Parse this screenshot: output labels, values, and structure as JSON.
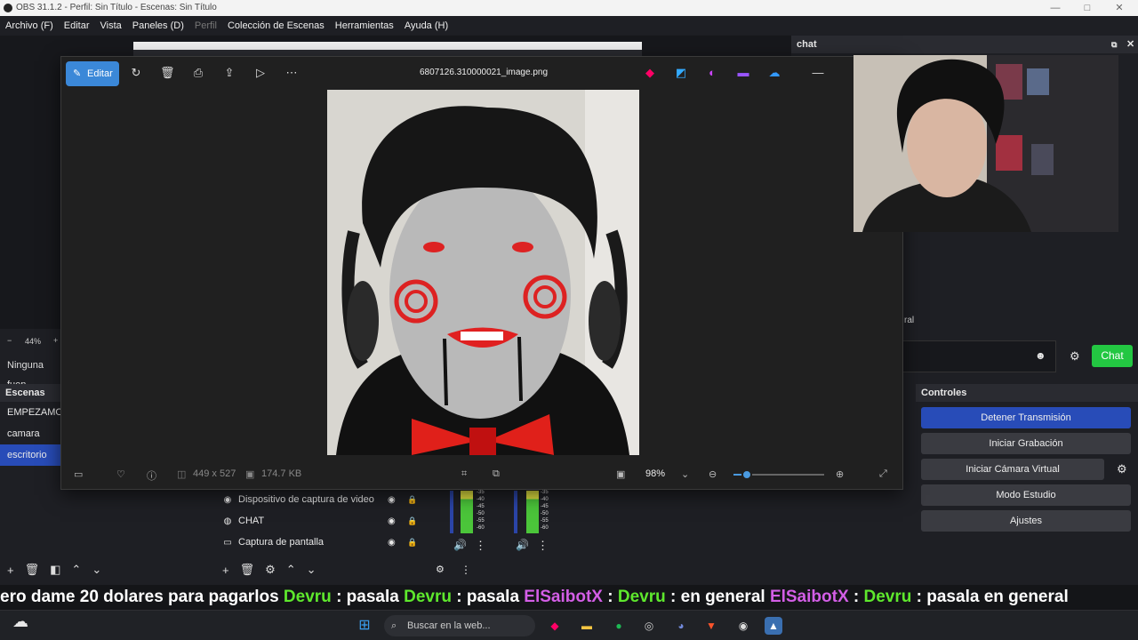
{
  "window": {
    "title": "OBS 31.1.2 - Perfil: Sin Título - Escenas: Sin Título"
  },
  "menu": [
    "Archivo (F)",
    "Editar",
    "Vista",
    "Paneles (D)",
    "Perfil",
    "Colección de Escenas",
    "Herramientas",
    "Ayuda (H)"
  ],
  "preview": {
    "zoom": "44%",
    "no_source": "Ninguna fuen"
  },
  "scenes": {
    "title": "Escenas",
    "items": [
      "EMPEZAMOS",
      "camara",
      "escritorio"
    ],
    "selected": "escritorio"
  },
  "sources": {
    "items": [
      "Dispositivo de captura de video",
      "CHAT",
      "Captura de pantalla"
    ]
  },
  "mixer": {
    "ticks": [
      "-35",
      "-40",
      "-45",
      "-50",
      "-55",
      "-60"
    ]
  },
  "chat_dock": {
    "title": "chat",
    "partial_text": "ral",
    "send_label": "Chat"
  },
  "controls": {
    "title": "Controles",
    "buttons": [
      "Detener Transmisión",
      "Iniciar Grabación",
      "Iniciar Cámara Virtual",
      "Modo Estudio",
      "Ajustes"
    ]
  },
  "viewer": {
    "edit_label": "Editar",
    "filename": "6807126.310000021_image.png",
    "dimensions": "449 x 527",
    "filesize": "174.7 KB",
    "zoom": "98%",
    "zoom_fraction": 0.15
  },
  "ticker": [
    {
      "t": "ero dame 20 dolares para pagarlos",
      "c": "w"
    },
    {
      "t": "Devru",
      "c": "g"
    },
    {
      "t": ": pasala",
      "c": "w"
    },
    {
      "t": "Devru",
      "c": "g"
    },
    {
      "t": ": pasala",
      "c": "w"
    },
    {
      "t": "ElSaibotX",
      "c": "p"
    },
    {
      "t": ":",
      "c": "w"
    },
    {
      "t": "Devru",
      "c": "g"
    },
    {
      "t": ": en general",
      "c": "w"
    },
    {
      "t": "ElSaibotX",
      "c": "p"
    },
    {
      "t": ":",
      "c": "w"
    },
    {
      "t": "Devru",
      "c": "g"
    },
    {
      "t": ": pasala en general",
      "c": "w"
    }
  ],
  "taskbar": {
    "search_placeholder": "Buscar en la web..."
  }
}
